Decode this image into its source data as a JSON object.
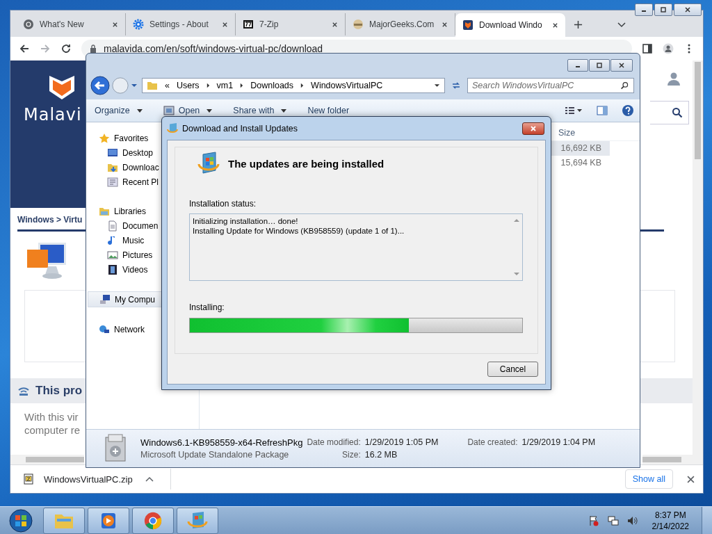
{
  "browser": {
    "tabs": [
      {
        "title": "What's New",
        "kind": "chrome",
        "selected": false
      },
      {
        "title": "Settings - About",
        "kind": "gear",
        "selected": false
      },
      {
        "title": "7-Zip",
        "kind": "zip",
        "selected": false
      },
      {
        "title": "MajorGeeks.Com",
        "kind": "geek",
        "selected": false
      },
      {
        "title": "Download Windo",
        "kind": "shield",
        "selected": true
      }
    ],
    "address": "malavida.com/en/soft/windows-virtual-pc/download",
    "page": {
      "logo": "Malavi",
      "breadcrumb": "Windows > Virtu",
      "section_title": "This pro",
      "body_lines": [
        "With this vir",
        "computer re"
      ]
    },
    "download_bar": {
      "file": "WindowsVirtualPC.zip",
      "show_all": "Show all"
    }
  },
  "explorer": {
    "path_prefix": "«",
    "path": [
      "Users",
      "vm1",
      "Downloads",
      "WindowsVirtualPC"
    ],
    "search": {
      "placeholder": "Search WindowsVirtualPC"
    },
    "toolbar": [
      {
        "label": "Organize",
        "kind": "menu"
      },
      {
        "label": "Open",
        "kind": "open"
      },
      {
        "label": "Share with",
        "kind": "menu"
      },
      {
        "label": "New folder",
        "kind": "plain"
      }
    ],
    "nav": [
      {
        "label": "Favorites",
        "kind": "star",
        "selected": false,
        "children": [
          {
            "label": "Desktop",
            "kind": "desktop",
            "selected": false
          },
          {
            "label": "Downloac",
            "kind": "downloads",
            "selected": false
          },
          {
            "label": "Recent Pl",
            "kind": "recent",
            "selected": false
          }
        ]
      },
      {
        "label": "Libraries",
        "kind": "library",
        "selected": false,
        "children": [
          {
            "label": "Documen",
            "kind": "document",
            "selected": false
          },
          {
            "label": "Music",
            "kind": "music",
            "selected": false
          },
          {
            "label": "Pictures",
            "kind": "pictures",
            "selected": false
          },
          {
            "label": "Videos",
            "kind": "videos",
            "selected": false
          }
        ]
      },
      {
        "label": "My Compu",
        "kind": "computer",
        "selected": true
      },
      {
        "label": "Network",
        "kind": "network",
        "selected": false
      }
    ],
    "columns": [
      "Size"
    ],
    "rows": [
      {
        "size": "16,692 KB",
        "selected": true
      },
      {
        "size": "15,694 KB",
        "selected": false
      }
    ],
    "details": {
      "name": "Windows6.1-KB958559-x64-RefreshPkg",
      "type": "Microsoft Update Standalone Package",
      "fields": [
        {
          "label": "Date modified:",
          "value": "1/29/2019 1:05 PM"
        },
        {
          "label": "Size:",
          "value": "16.2 MB"
        },
        {
          "label": "Date created:",
          "value": "1/29/2019 1:04 PM"
        }
      ]
    }
  },
  "dialog": {
    "title": "Download and Install Updates",
    "heading": "The updates are being installed",
    "status_label": "Installation status:",
    "log": [
      "Initializing installation… done!",
      "Installing Update for Windows (KB958559) (update 1 of 1)..."
    ],
    "progress_label": "Installing:",
    "progress": {
      "level": 0.66
    },
    "buttons": [
      "Cancel"
    ]
  },
  "taskbar": {
    "items": [
      {
        "kind": "folder"
      },
      {
        "kind": "media"
      },
      {
        "kind": "chrome"
      },
      {
        "kind": "update"
      }
    ],
    "time": "8:37 PM",
    "date": "2/14/2022"
  }
}
